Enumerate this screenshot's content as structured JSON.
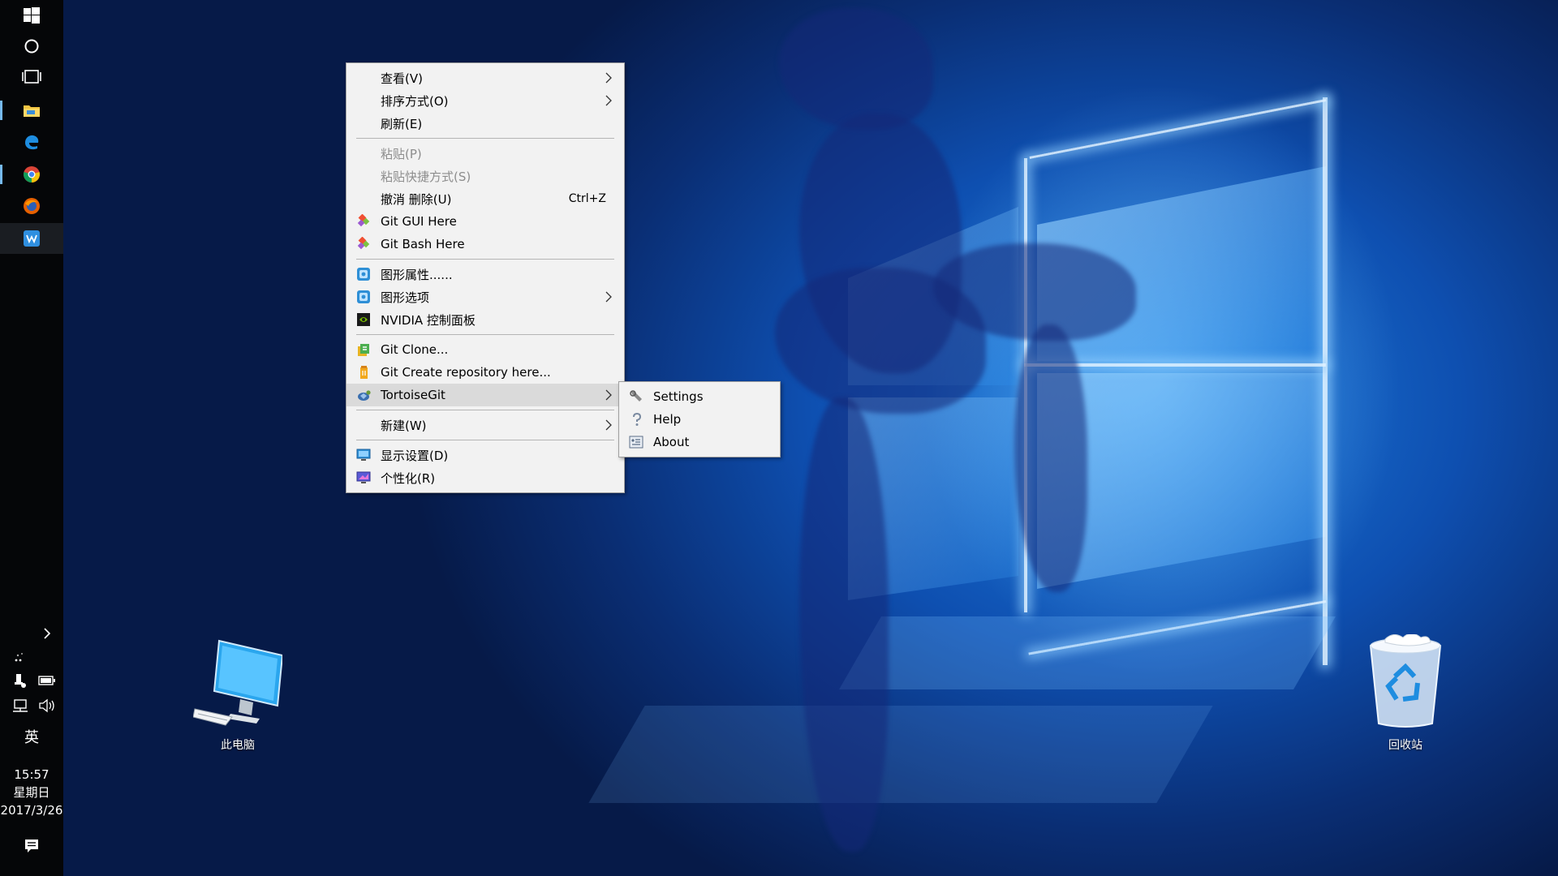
{
  "taskbar": {
    "time": "15:57",
    "weekday": "星期日",
    "date": "2017/3/26",
    "ime": "英",
    "pinned": [
      "windows-start",
      "cortana-search",
      "task-view",
      "file-explorer",
      "edge",
      "chrome",
      "firefox",
      "wps-writer"
    ],
    "accent_color": "#76b9ed"
  },
  "desktop_icons": {
    "this_pc": "此电脑",
    "recycle_bin": "回收站"
  },
  "context_menu": {
    "view": "查看(V)",
    "sort_by": "排序方式(O)",
    "refresh": "刷新(E)",
    "paste": "粘贴(P)",
    "paste_shortcut": "粘贴快捷方式(S)",
    "undo_delete": "撤消 删除(U)",
    "undo_shortcut": "Ctrl+Z",
    "git_gui": "Git GUI Here",
    "git_bash": "Git Bash Here",
    "graphics_properties": "图形属性......",
    "graphics_options": "图形选项",
    "nvidia": "NVIDIA 控制面板",
    "git_clone": "Git Clone...",
    "git_create_repo": "Git Create repository here...",
    "tortoisegit": "TortoiseGit",
    "new": "新建(W)",
    "display_settings": "显示设置(D)",
    "personalize": "个性化(R)"
  },
  "tortoisegit_submenu": {
    "settings": "Settings",
    "help": "Help",
    "about": "About"
  }
}
